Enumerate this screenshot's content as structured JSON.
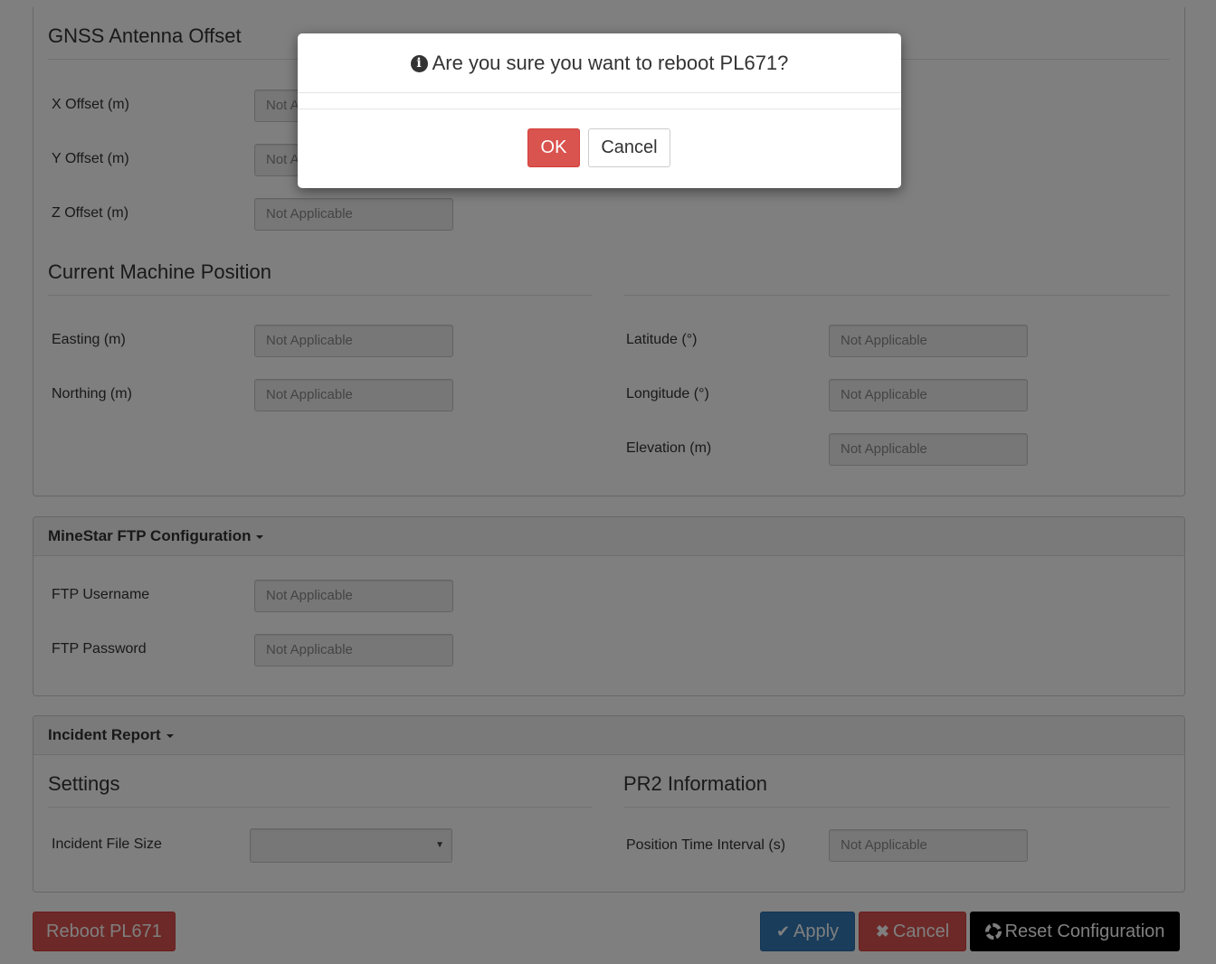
{
  "gnss": {
    "title": "GNSS Antenna Offset",
    "x_label": "X Offset (m)",
    "x_value": "Not Applicable",
    "y_label": "Y Offset (m)",
    "y_value": "Not Applicable",
    "z_label": "Z Offset (m)",
    "z_value": "Not Applicable"
  },
  "machine_position": {
    "title": "Current Machine Position",
    "easting_label": "Easting (m)",
    "easting_value": "Not Applicable",
    "northing_label": "Northing (m)",
    "northing_value": "Not Applicable",
    "latitude_label": "Latitude (°)",
    "latitude_value": "Not Applicable",
    "longitude_label": "Longitude (°)",
    "longitude_value": "Not Applicable",
    "elevation_label": "Elevation (m)",
    "elevation_value": "Not Applicable"
  },
  "ftp": {
    "title": "MineStar FTP Configuration",
    "username_label": "FTP Username",
    "username_value": "Not Applicable",
    "password_label": "FTP Password",
    "password_value": "Not Applicable"
  },
  "incident": {
    "title": "Incident Report",
    "settings_title": "Settings",
    "file_size_label": "Incident File Size",
    "file_size_value": "",
    "pr2_title": "PR2 Information",
    "interval_label": "Position Time Interval (s)",
    "interval_value": "Not Applicable"
  },
  "footer": {
    "reboot_label": "Reboot PL671",
    "apply_label": "Apply",
    "cancel_label": "Cancel",
    "reset_label": "Reset Configuration"
  },
  "dialog": {
    "message": "Are you sure you want to reboot PL671?",
    "ok_label": "OK",
    "cancel_label": "Cancel"
  },
  "colors": {
    "danger": "#d9534f",
    "primary": "#337ab7",
    "dark": "#000000",
    "overlay": "rgba(0,0,0,0.5)"
  },
  "icons": {
    "dialog": "info-circle-icon",
    "apply": "check-icon",
    "cancel": "x-icon",
    "reset": "life-ring-icon",
    "dropdown": "caret-down-icon"
  }
}
